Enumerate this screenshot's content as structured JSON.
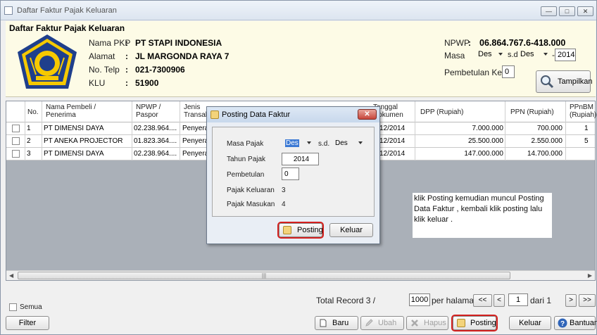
{
  "window": {
    "title": "Daftar Faktur Pajak Keluaran"
  },
  "header": {
    "title": "Daftar Faktur Pajak Keluaran",
    "nama_label": "Nama PKP",
    "nama_value": "PT STAPI INDONESIA",
    "alamat_label": "Alamat",
    "alamat_value": "JL MARGONDA RAYA 7",
    "telp_label": "No. Telp",
    "telp_value": "021-7300906",
    "klu_label": "KLU",
    "klu_value": "51900",
    "colon": ":",
    "npwp_label": "NPWP",
    "npwp_colon": ":",
    "npwp_value": "06.864.767.6-418.000",
    "masa_label": "Masa",
    "masa_from": "Des",
    "masa_sd": "s.d",
    "masa_to": "Des",
    "masa_dash": "-",
    "year": "2014",
    "pembetulan_label": "Pembetulan Ke",
    "pembetulan_value": "0",
    "tampilkan": "Tampilkan"
  },
  "table": {
    "columns": [
      "No.",
      "Nama Pembeli / Penerima",
      "NPWP / Paspor",
      "Jenis Transaksi",
      "Tanggal Dokumen",
      "DPP (Rupiah)",
      "PPN (Rupiah)",
      "PPnBM (Rupiah)"
    ],
    "rows": [
      {
        "no": "1",
        "nama": "PT DIMENSI DAYA",
        "npwp": "02.238.964....",
        "jenis": "Penyerah",
        "tgl": "12/2014",
        "dpp": "7.000.000",
        "ppn": "700.000",
        "ppnbm": "1"
      },
      {
        "no": "2",
        "nama": "PT ANEKA PROJECTOR",
        "npwp": "01.823.364....",
        "jenis": "Penyerah",
        "tgl": "12/2014",
        "dpp": "25.500.000",
        "ppn": "2.550.000",
        "ppnbm": "5"
      },
      {
        "no": "3",
        "nama": "PT DIMENSI DAYA",
        "npwp": "02.238.964....",
        "jenis": "Penyerah",
        "tgl": "12/2014",
        "dpp": "147.000.000",
        "ppn": "14.700.000",
        "ppnbm": ""
      }
    ]
  },
  "dialog": {
    "title": "Posting Data Faktur",
    "masa_pajak_label": "Masa Pajak",
    "masa_from": "Des",
    "masa_sd": "s.d.",
    "masa_to": "Des",
    "tahun_label": "Tahun Pajak",
    "tahun_value": "2014",
    "pembetulan_label": "Pembetulan",
    "pembetulan_value": "0",
    "keluaran_label": "Pajak Keluaran",
    "keluaran_value": "3",
    "masukan_label": "Pajak Masukan",
    "masukan_value": "4",
    "posting_label": "Posting",
    "keluar_label": "Keluar"
  },
  "note": {
    "text": "klik Posting kemudian muncul Posting Data Faktur , kembali klik posting lalu klik keluar ."
  },
  "footer": {
    "total_record": "Total Record 3 /",
    "per_page_value": "1000",
    "per_halaman": "per halaman",
    "first": "<<",
    "prev": "<",
    "page_value": "1",
    "dari": "dari 1",
    "next": ">",
    "last": ">>",
    "semua": "Semua",
    "filter": "Filter",
    "baru": "Baru",
    "ubah": "Ubah",
    "hapus": "Hapus",
    "posting": "Posting",
    "keluar": "Keluar",
    "bantuan": "Bantuan"
  }
}
